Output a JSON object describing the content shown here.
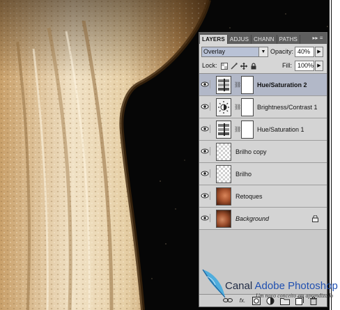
{
  "panel": {
    "tabs": [
      {
        "label": "LAYERS"
      },
      {
        "label": "ADJUS"
      },
      {
        "label": "CHANN"
      },
      {
        "label": "PATHS"
      }
    ],
    "menu_glyph": "▸▸ ≡",
    "blend_mode": "Overlay",
    "opacity_label": "Opacity:",
    "opacity_value": "40%",
    "lock_label": "Lock:",
    "fill_label": "Fill:",
    "fill_value": "100%",
    "layers": [
      {
        "name": "Hue/Saturation 2",
        "type": "adjustment-hue",
        "selected": true,
        "bold": true
      },
      {
        "name": "Brightness/Contrast 1",
        "type": "adjustment-brightness",
        "selected": false
      },
      {
        "name": "Hue/Saturation 1",
        "type": "adjustment-hue",
        "selected": false
      },
      {
        "name": "Brilho copy",
        "type": "transparent",
        "selected": false
      },
      {
        "name": "Brilho",
        "type": "transparent",
        "selected": false
      },
      {
        "name": "Retoques",
        "type": "photo",
        "selected": false
      },
      {
        "name": "Background",
        "type": "photo",
        "selected": false,
        "italic": true,
        "locked": true
      }
    ],
    "footer_buttons": [
      "link-icon",
      "fx-icon",
      "mask-icon",
      "adjustment-icon",
      "group-icon",
      "new-layer-icon",
      "trash-icon"
    ],
    "fx_label": "fx."
  },
  "watermark": {
    "brand_part1": "Canal ",
    "brand_part2": "Adobe Photoshop",
    "tagline": "Um novo conceito em aprendizado"
  },
  "colors": {
    "panel_bg": "#d6d6d6",
    "selected_layer": "#b2b8c8",
    "tab_bar": "#5e5e5e",
    "accent_blue": "#1f4fb0"
  }
}
